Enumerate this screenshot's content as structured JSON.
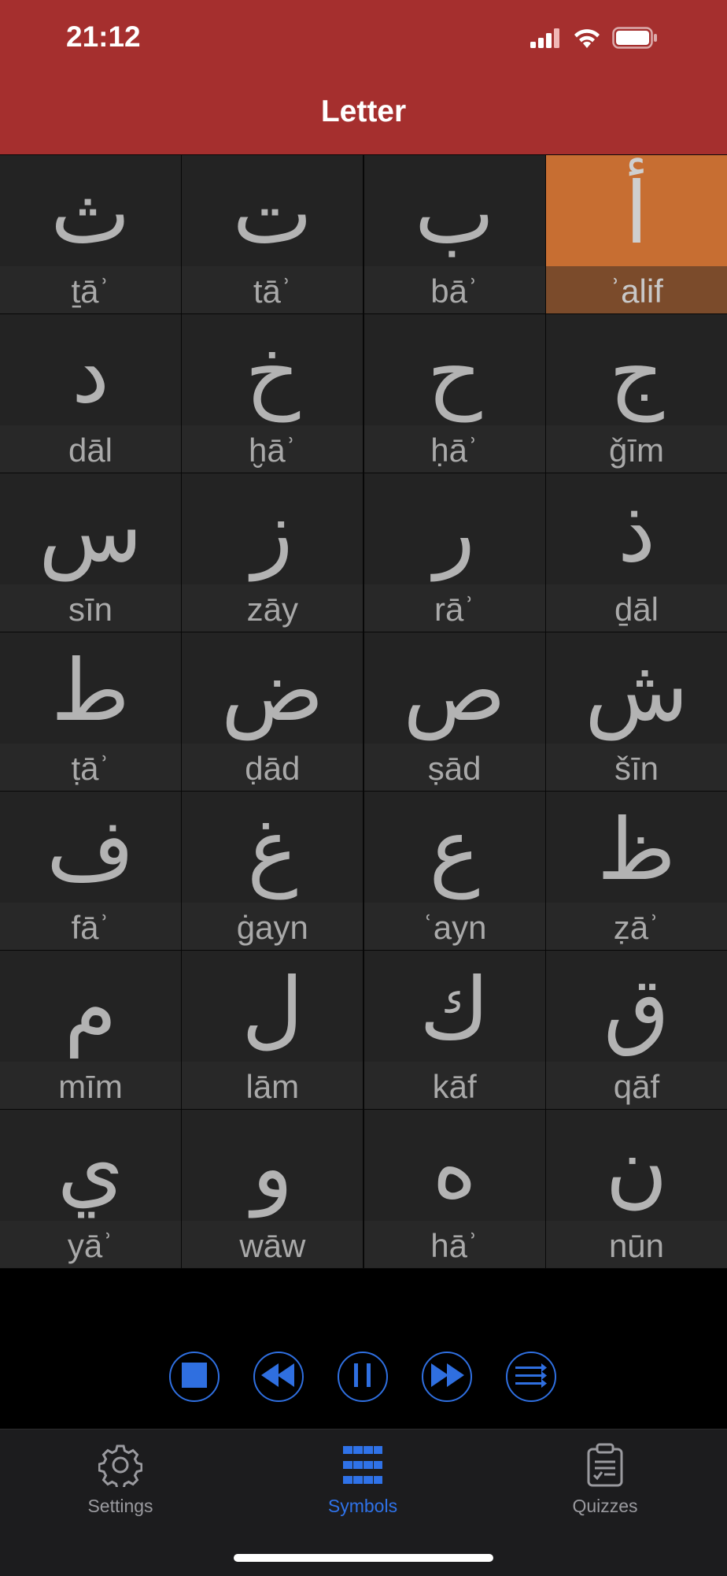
{
  "status_bar": {
    "time": "21:12"
  },
  "header": {
    "title": "Letter"
  },
  "letters": [
    {
      "glyph": "ث",
      "name": "ṯāʾ"
    },
    {
      "glyph": "ت",
      "name": "tāʾ"
    },
    {
      "glyph": "ب",
      "name": "bāʾ"
    },
    {
      "glyph": "أ",
      "name": "ʾalif",
      "selected": true
    },
    {
      "glyph": "د",
      "name": "dāl"
    },
    {
      "glyph": "خ",
      "name": "ḫāʾ"
    },
    {
      "glyph": "ح",
      "name": "ḥāʾ"
    },
    {
      "glyph": "ج",
      "name": "ǧīm"
    },
    {
      "glyph": "س",
      "name": "sīn"
    },
    {
      "glyph": "ز",
      "name": "zāy"
    },
    {
      "glyph": "ر",
      "name": "rāʾ"
    },
    {
      "glyph": "ذ",
      "name": "ḏāl"
    },
    {
      "glyph": "ط",
      "name": "ṭāʾ"
    },
    {
      "glyph": "ض",
      "name": "ḍād"
    },
    {
      "glyph": "ص",
      "name": "ṣād"
    },
    {
      "glyph": "ش",
      "name": "šīn"
    },
    {
      "glyph": "ف",
      "name": "fāʾ"
    },
    {
      "glyph": "غ",
      "name": "ġayn"
    },
    {
      "glyph": "ع",
      "name": "ʿayn"
    },
    {
      "glyph": "ظ",
      "name": "ẓāʾ"
    },
    {
      "glyph": "م",
      "name": "mīm"
    },
    {
      "glyph": "ل",
      "name": "lām"
    },
    {
      "glyph": "ك",
      "name": "kāf"
    },
    {
      "glyph": "ق",
      "name": "qāf"
    },
    {
      "glyph": "ي",
      "name": "yāʾ"
    },
    {
      "glyph": "و",
      "name": "wāw"
    },
    {
      "glyph": "ه",
      "name": "hāʾ"
    },
    {
      "glyph": "ن",
      "name": "nūn"
    }
  ],
  "player": {
    "buttons": [
      "stop-icon",
      "rewind-icon",
      "pause-icon",
      "fast-forward-icon",
      "playlist-icon"
    ],
    "accent": "#2f6fe0"
  },
  "tab_bar": {
    "tabs": [
      {
        "label": "Settings",
        "icon": "gear-icon"
      },
      {
        "label": "Symbols",
        "icon": "grid-icon",
        "active": true
      },
      {
        "label": "Quizzes",
        "icon": "clipboard-icon"
      }
    ]
  },
  "colors": {
    "header": "#a52f2e",
    "selected_cell": "#c76e32",
    "cell": "#232323",
    "active_tab": "#2f72e8"
  }
}
